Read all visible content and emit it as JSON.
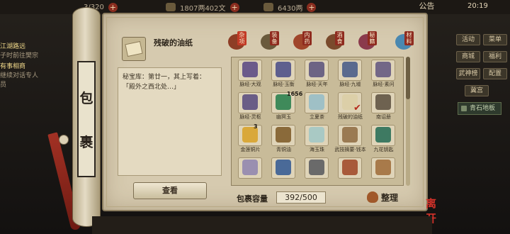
{
  "topbar": {
    "resource1": "3/320",
    "resource2": "1807两402文",
    "resource3": "6430两",
    "notice_label": "公告",
    "clock": "20:19"
  },
  "quest": {
    "title1": "江湖路远",
    "text1": "子时前往樊宗",
    "title2": "有事相商",
    "text2": "继续对话专人",
    "text3": "员"
  },
  "side_menu": {
    "btn1": "活动",
    "btn2": "菜单",
    "btn3": "商城",
    "btn4": "福利",
    "btn5": "武神榜",
    "btn6": "配置",
    "btn7": "冀宫",
    "task": "青石地板"
  },
  "scroll_label": [
    "包",
    "裹"
  ],
  "detail": {
    "item_name": "残破的油纸",
    "desc_line1": "秘宝库：第廿一，其上写着：",
    "desc_line2": "「殿外之西北处…」",
    "view_button": "查看"
  },
  "tabs": [
    {
      "label": "杂项",
      "color": "#8d3d25",
      "active": true
    },
    {
      "label": "装备",
      "color": "#6a5a3c"
    },
    {
      "label": "内药",
      "color": "#a0452a"
    },
    {
      "label": "酒食",
      "color": "#7a4a2c"
    },
    {
      "label": "秘籍",
      "color": "#8a3a4c"
    },
    {
      "label": "材料",
      "color": "#4a88b0"
    }
  ],
  "grid_items": [
    {
      "name": "脉经·大观",
      "color": "#6b5a8a"
    },
    {
      "name": "脉经·玉衡",
      "color": "#5e5f8e"
    },
    {
      "name": "脉经·天年",
      "color": "#6d6484"
    },
    {
      "name": "脉经·九墟",
      "color": "#5a6a8e"
    },
    {
      "name": "脉经·素问",
      "color": "#736787"
    },
    {
      "name": "脉经·灵枢",
      "color": "#6a5d86"
    },
    {
      "name": "幽冥玉",
      "color": "#3f8a5a",
      "qty": "1656"
    },
    {
      "name": "立夏茶",
      "color": "#9fc0c6"
    },
    {
      "name": "残破的油纸",
      "color": "#dccfa8",
      "checked": true
    },
    {
      "name": "南诏册",
      "color": "#6e6250"
    },
    {
      "name": "金莲铜片",
      "color": "#d9a83a",
      "qty": "3"
    },
    {
      "name": "青铜油",
      "color": "#8a6a3a"
    },
    {
      "name": "海玉珠",
      "color": "#a9c9c4"
    },
    {
      "name": "武技摘要·钱本",
      "color": "#9a7a52"
    },
    {
      "name": "九花钥匙",
      "color": "#3e7a62"
    },
    {
      "name": "",
      "color": "#9a8fb0"
    },
    {
      "name": "",
      "color": "#4a6a98"
    },
    {
      "name": "",
      "color": "#6a6a6a"
    },
    {
      "name": "",
      "color": "#a85a3a"
    },
    {
      "name": "",
      "color": "#a87a4a"
    }
  ],
  "capacity": {
    "label": "包裹容量",
    "value": "392/500"
  },
  "sort_button": "整理",
  "close_button": "离开",
  "chevron": "›"
}
